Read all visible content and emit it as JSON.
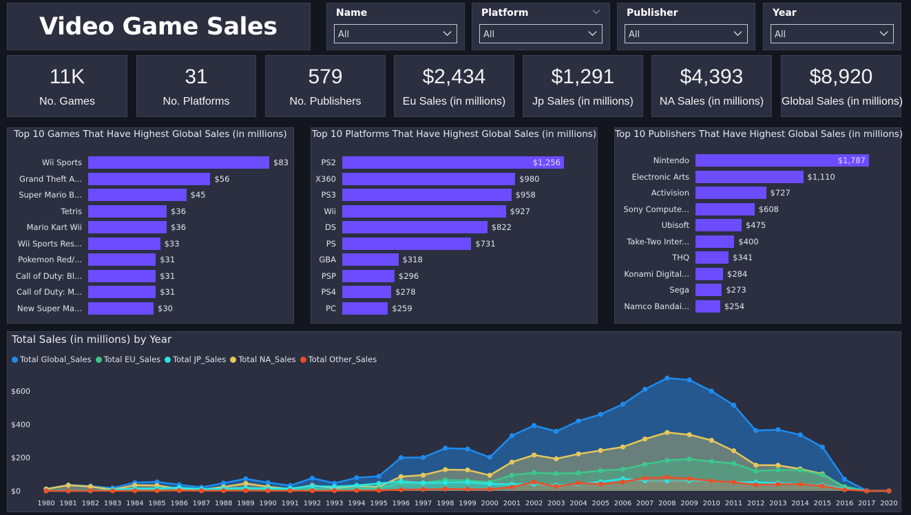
{
  "dashboard": {
    "title": "Video Game Sales"
  },
  "filters": [
    {
      "label": "Name",
      "value": "All"
    },
    {
      "label": "Platform",
      "value": "All"
    },
    {
      "label": "Publisher",
      "value": "All"
    },
    {
      "label": "Year",
      "value": "All"
    }
  ],
  "kpis": [
    {
      "value": "11K",
      "label": "No. Games"
    },
    {
      "value": "31",
      "label": "No. Platforms"
    },
    {
      "value": "579",
      "label": "No. Publishers"
    },
    {
      "value": "$2,434",
      "label": "Eu Sales (in millions)"
    },
    {
      "value": "$1,291",
      "label": "Jp Sales (in millions)"
    },
    {
      "value": "$4,393",
      "label": "NA Sales (in millions)"
    },
    {
      "value": "$8,920",
      "label": "Global Sales (in millions)"
    }
  ],
  "colors": {
    "bar": "#6c4cff",
    "global": "#1e8cf0",
    "eu": "#3cc88c",
    "jp": "#28e6e6",
    "na": "#e6c85a",
    "other": "#e8502a"
  },
  "chart_data": [
    {
      "type": "bar",
      "orientation": "horizontal",
      "title": "Top 10 Games That Have Highest Global Sales (in millions)",
      "categories": [
        "Wii Sports",
        "Grand Theft A...",
        "Super Mario B...",
        "Tetris",
        "Mario Kart Wii",
        "Wii Sports Res...",
        "Pokemon Red/...",
        "Call of Duty: Bl...",
        "Call of Duty: M...",
        "New Super Ma..."
      ],
      "values": [
        83,
        56,
        45,
        36,
        36,
        33,
        31,
        31,
        31,
        30
      ],
      "labels": [
        "$83",
        "$56",
        "$45",
        "$36",
        "$36",
        "$33",
        "$31",
        "$31",
        "$31",
        "$30"
      ]
    },
    {
      "type": "bar",
      "orientation": "horizontal",
      "title": "Top 10 Platforms That Have Highest Global Sales (in millions)",
      "categories": [
        "PS2",
        "X360",
        "PS3",
        "Wii",
        "DS",
        "PS",
        "GBA",
        "PSP",
        "PS4",
        "PC"
      ],
      "values": [
        1256,
        980,
        958,
        927,
        822,
        731,
        318,
        296,
        278,
        259
      ],
      "labels": [
        "$1,256",
        "$980",
        "$958",
        "$927",
        "$822",
        "$731",
        "$318",
        "$296",
        "$278",
        "$259"
      ]
    },
    {
      "type": "bar",
      "orientation": "horizontal",
      "title": "Top 10 Publishers That Have Highest Global Sales (in millions)",
      "categories": [
        "Nintendo",
        "Electronic Arts",
        "Activision",
        "Sony Compute...",
        "Ubisoft",
        "Take-Two Inter...",
        "THQ",
        "Konami Digital...",
        "Sega",
        "Namco Bandai..."
      ],
      "values": [
        1787,
        1110,
        727,
        608,
        475,
        400,
        341,
        284,
        273,
        254
      ],
      "labels": [
        "$1,787",
        "$1,110",
        "$727",
        "$608",
        "$475",
        "$400",
        "$341",
        "$284",
        "$273",
        "$254"
      ]
    },
    {
      "type": "area",
      "title": "Total Sales (in millions) by Year",
      "x": [
        "1980",
        "1981",
        "1982",
        "1983",
        "1984",
        "1985",
        "1986",
        "1987",
        "1988",
        "1989",
        "1990",
        "1991",
        "1992",
        "1993",
        "1994",
        "1995",
        "1996",
        "1997",
        "1998",
        "1999",
        "2000",
        "2001",
        "2002",
        "2003",
        "2004",
        "2005",
        "2006",
        "2007",
        "2008",
        "2009",
        "2010",
        "2011",
        "2012",
        "2013",
        "2014",
        "2015",
        "2016",
        "2017",
        "2020"
      ],
      "yticks": [
        "$0",
        "$200",
        "$400",
        "$600"
      ],
      "ylim": [
        0,
        700
      ],
      "series": [
        {
          "name": "Total Global_Sales",
          "color": "#1e8cf0",
          "values": [
            12,
            36,
            29,
            17,
            50,
            54,
            37,
            22,
            47,
            73,
            50,
            32,
            76,
            46,
            79,
            88,
            200,
            201,
            257,
            252,
            202,
            332,
            393,
            358,
            420,
            460,
            521,
            611,
            678,
            667,
            600,
            516,
            363,
            368,
            337,
            264,
            70,
            1,
            0
          ]
        },
        {
          "name": "Total EU_Sales",
          "color": "#3cc88c",
          "values": [
            1,
            2,
            2,
            1,
            2,
            5,
            3,
            2,
            7,
            9,
            8,
            4,
            11,
            4,
            14,
            14,
            47,
            49,
            66,
            63,
            52,
            95,
            109,
            104,
            108,
            122,
            130,
            160,
            184,
            191,
            177,
            165,
            119,
            126,
            125,
            97,
            26,
            0,
            0
          ]
        },
        {
          "name": "Total JP_Sales",
          "color": "#28e6e6",
          "values": [
            0,
            0,
            0,
            8,
            14,
            15,
            20,
            11,
            15,
            18,
            15,
            15,
            29,
            26,
            33,
            45,
            57,
            48,
            50,
            53,
            42,
            40,
            41,
            34,
            41,
            55,
            73,
            61,
            60,
            61,
            59,
            53,
            52,
            47,
            40,
            34,
            13,
            0,
            0
          ]
        },
        {
          "name": "Total NA_Sales",
          "color": "#e6c85a",
          "values": [
            11,
            34,
            26,
            8,
            34,
            33,
            12,
            8,
            24,
            45,
            25,
            12,
            33,
            16,
            29,
            25,
            86,
            95,
            128,
            126,
            94,
            173,
            216,
            193,
            222,
            243,
            264,
            312,
            351,
            338,
            304,
            241,
            155,
            154,
            132,
            102,
            22,
            0,
            0
          ]
        },
        {
          "name": "Total Other_Sales",
          "color": "#e8502a",
          "values": [
            0,
            0,
            1,
            0,
            1,
            1,
            2,
            1,
            1,
            2,
            1,
            1,
            1,
            1,
            3,
            3,
            7,
            9,
            11,
            10,
            10,
            23,
            53,
            27,
            47,
            41,
            54,
            77,
            82,
            74,
            60,
            53,
            37,
            40,
            40,
            30,
            7,
            0,
            0
          ]
        }
      ]
    }
  ]
}
